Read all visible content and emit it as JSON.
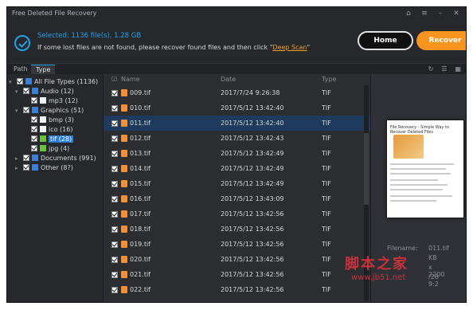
{
  "window": {
    "title": "Free Deleted File Recovery"
  },
  "header": {
    "selected_text": "Selected: 1136 file(s), 1.28 GB",
    "hint_prefix": "If some lost files are not found, please recover found files and then click \"",
    "hint_link": "Deep Scan",
    "hint_suffix": "\"",
    "home_label": "Home",
    "recover_label": "Recover"
  },
  "tabs": [
    {
      "label": "Path"
    },
    {
      "label": "Type"
    }
  ],
  "tree": [
    {
      "label": "All File Types (1136)",
      "icon": "folder"
    },
    {
      "label": "Audio (12)",
      "icon": "folder"
    },
    {
      "label": "mp3 (12)",
      "icon": "doc"
    },
    {
      "label": "Graphics (51)",
      "icon": "folder"
    },
    {
      "label": "bmp (3)",
      "icon": "doc"
    },
    {
      "label": "ico (16)",
      "icon": "doc"
    },
    {
      "label": "tif (28)",
      "icon": "img"
    },
    {
      "label": "jpg (4)",
      "icon": "img"
    },
    {
      "label": "Documents (991)",
      "icon": "folder"
    },
    {
      "label": "Other (8?)",
      "icon": "folder"
    }
  ],
  "list": {
    "columns": {
      "name": "Name",
      "date": "Date",
      "type": "Type"
    },
    "rows": [
      {
        "name": "009.tif",
        "date": "2017/7/24 9:26:38",
        "type": "TIF"
      },
      {
        "name": "010.tif",
        "date": "2017/5/12 13:42:40",
        "type": "TIF"
      },
      {
        "name": "011.tif",
        "date": "2017/5/12 13:42:40",
        "type": "TIF"
      },
      {
        "name": "012.tif",
        "date": "2017/5/12 13:42:43",
        "type": "TIF"
      },
      {
        "name": "013.tif",
        "date": "2017/5/12 13:42:49",
        "type": "TIF"
      },
      {
        "name": "014.tif",
        "date": "2017/5/12 13:42:49",
        "type": "TIF"
      },
      {
        "name": "015.tif",
        "date": "2017/5/12 13:42:49",
        "type": "TIF"
      },
      {
        "name": "016.tif",
        "date": "2017/5/12 13:43:09",
        "type": "TIF"
      },
      {
        "name": "017.tif",
        "date": "2017/5/12 13:42:56",
        "type": "TIF"
      },
      {
        "name": "018.tif",
        "date": "2017/5/12 13:42:56",
        "type": "TIF"
      },
      {
        "name": "019.tif",
        "date": "2017/5/12 13:42:56",
        "type": "TIF"
      },
      {
        "name": "020.tif",
        "date": "2017/5/12 13:42:56",
        "type": "TIF"
      },
      {
        "name": "021.tif",
        "date": "2017/5/12 13:42:56",
        "type": "TIF"
      },
      {
        "name": "022.tif",
        "date": "2017/5/12 13:42:56",
        "type": "TIF"
      }
    ]
  },
  "preview": {
    "doc_title": "File Recovery - Simple Way to Recover Deleted Files",
    "filename_label": "Filename:",
    "filename_value": "011.tif",
    "size_value": "KB",
    "dims_value": "x 2200",
    "modified_value": "/26 9:2"
  },
  "watermark": {
    "text": "脚本之家",
    "url": "www.jb51.net"
  },
  "colors": {
    "accent": "#21a3e8",
    "recover": "#f7941d",
    "link": "#f7a11a"
  }
}
